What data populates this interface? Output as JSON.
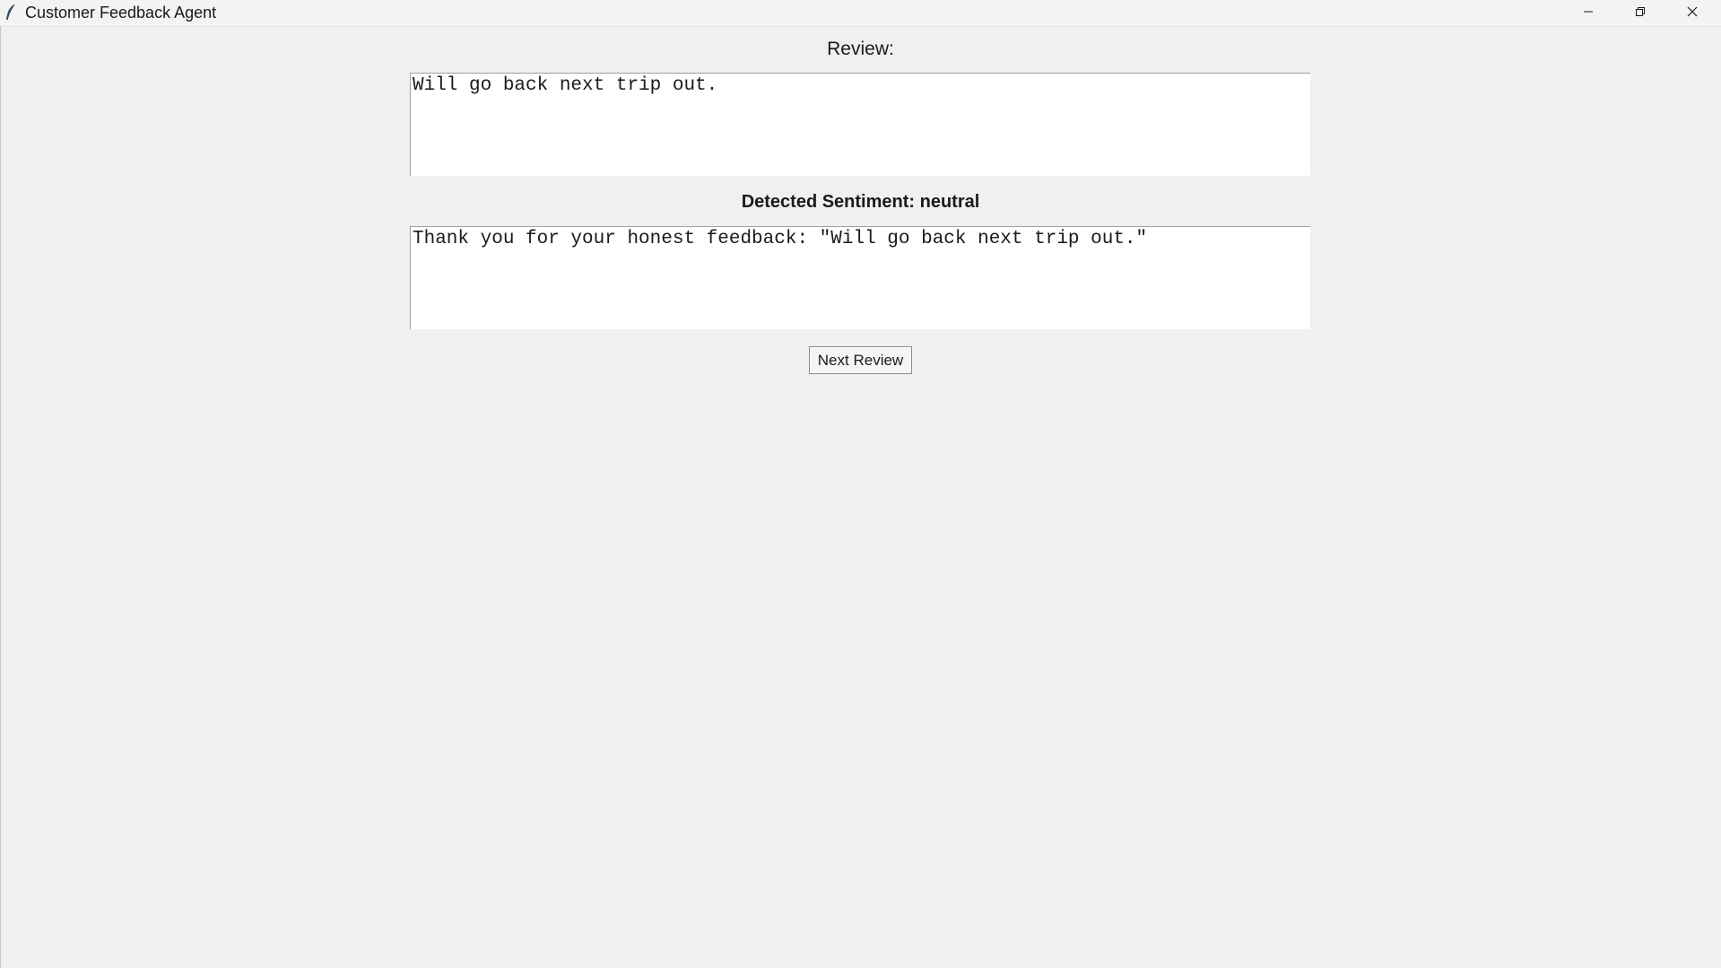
{
  "window": {
    "title": "Customer Feedback Agent",
    "icons": {
      "app": "feather-icon",
      "minimize": "minimize-icon",
      "maximize": "restore-icon",
      "close": "close-icon"
    }
  },
  "review": {
    "label": "Review:",
    "text": "Will go back next trip out."
  },
  "sentiment": {
    "label": "Detected Sentiment: neutral"
  },
  "response": {
    "text": "Thank you for your honest feedback: \"Will go back next trip out.\""
  },
  "actions": {
    "next_label": "Next Review"
  }
}
